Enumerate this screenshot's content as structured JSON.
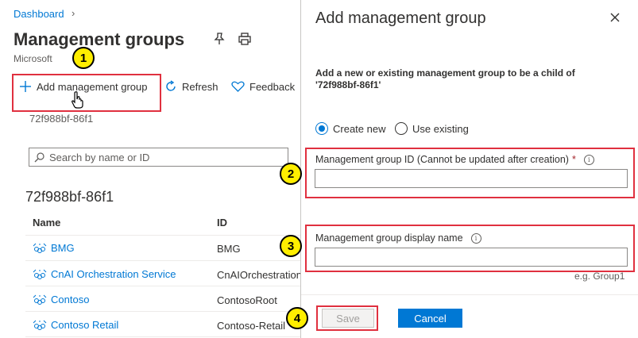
{
  "breadcrumb": {
    "label": "Dashboard"
  },
  "page": {
    "title": "Management groups",
    "subtitle": "Microsoft"
  },
  "toolbar": {
    "add_label": "Add management group",
    "refresh_label": "Refresh",
    "feedback_label": "Feedback"
  },
  "scope_label": "72f988bf-86f1",
  "search": {
    "placeholder": "Search by name or ID"
  },
  "section_title": "72f988bf-86f1",
  "table": {
    "headers": {
      "name": "Name",
      "id": "ID"
    },
    "rows": [
      {
        "name": "BMG",
        "id": "BMG"
      },
      {
        "name": "CnAI Orchestration Service",
        "id": "CnAIOrchestration"
      },
      {
        "name": "Contoso",
        "id": "ContosoRoot"
      },
      {
        "name": "Contoso Retail",
        "id": "Contoso-Retail"
      }
    ]
  },
  "panel": {
    "title": "Add management group",
    "description": "Add a new or existing management group to be a child of '72f988bf-86f1'",
    "radio_create": "Create new",
    "radio_existing": "Use existing",
    "field_id_label": "Management group ID (Cannot be updated after creation)",
    "required_mark": "*",
    "field_name_label": "Management group display name",
    "example": "e.g. Group1",
    "save_label": "Save",
    "cancel_label": "Cancel"
  },
  "markers": [
    "1",
    "2",
    "3",
    "4"
  ],
  "colors": {
    "accent": "#0078d4",
    "highlight": "#e0303f",
    "marker": "#ffee00"
  }
}
